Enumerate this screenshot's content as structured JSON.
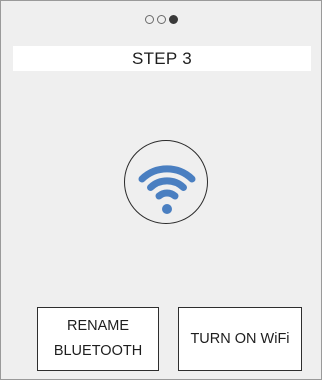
{
  "progress": {
    "step_index": 3,
    "total_steps": 3
  },
  "header": {
    "title": "STEP 3"
  },
  "status_icon": {
    "icon": "wifi-icon",
    "color": "#4a7fc1"
  },
  "actions": {
    "rename_bluetooth_label": "RENAME BLUETOOTH",
    "turn_on_wifi_label": "TURN ON WiFi"
  }
}
